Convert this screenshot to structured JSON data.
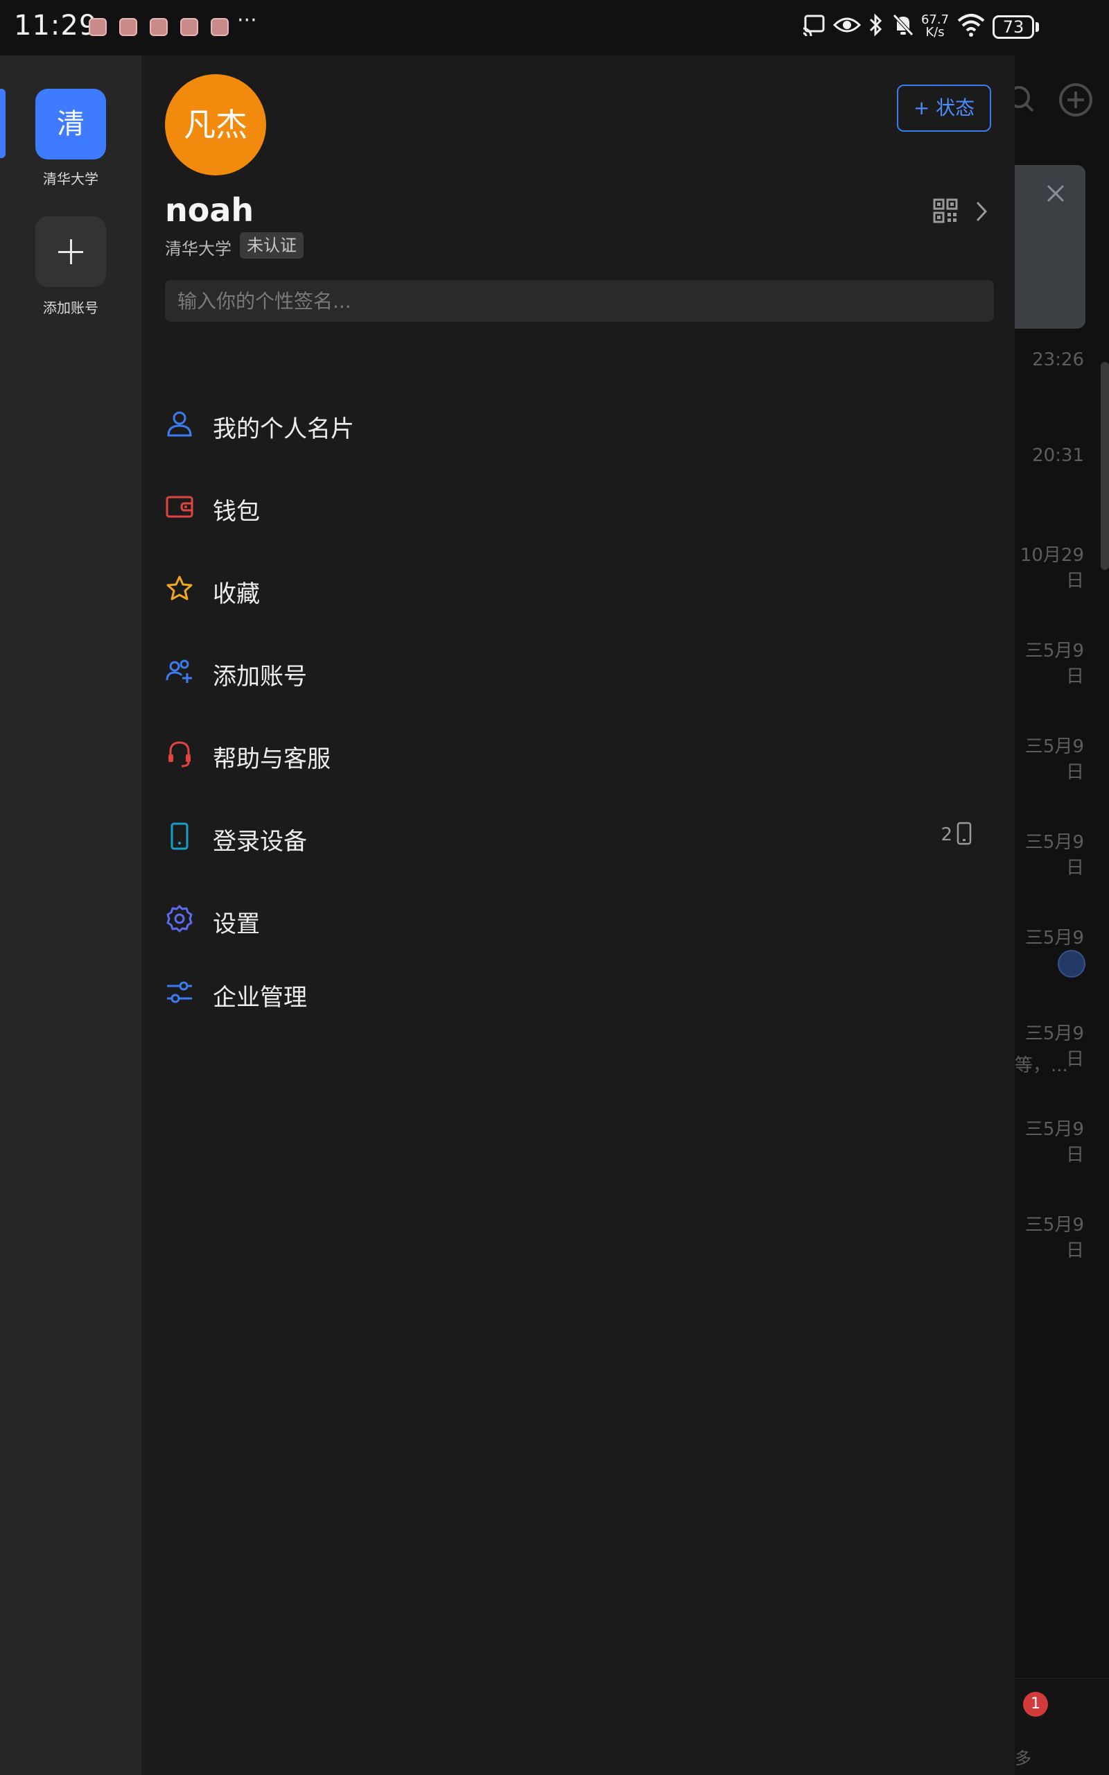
{
  "status_bar": {
    "time": "11:29",
    "more": "···",
    "net_speed_value": "67.7",
    "net_speed_unit": "K/s",
    "battery": "73"
  },
  "account_rail": {
    "org_avatar_text": "清",
    "org_label": "清华大学",
    "add_account_label": "添加账号"
  },
  "profile": {
    "avatar_text": "凡杰",
    "status_button_label": "+ 状态",
    "username": "noah",
    "org_name": "清华大学",
    "verify_badge": "未认证",
    "signature_placeholder": "输入你的个性签名..."
  },
  "menu": {
    "items": [
      {
        "label": "我的个人名片",
        "icon": "person-icon",
        "color": "#3b7df0"
      },
      {
        "label": "钱包",
        "icon": "wallet-icon",
        "color": "#e0443e"
      },
      {
        "label": "收藏",
        "icon": "star-icon",
        "color": "#f2a71b"
      },
      {
        "label": "添加账号",
        "icon": "add-user-icon",
        "color": "#3b7df0"
      },
      {
        "label": "帮助与客服",
        "icon": "headset-icon",
        "color": "#e0443e"
      },
      {
        "label": "登录设备",
        "icon": "phone-icon",
        "color": "#19a0c8"
      },
      {
        "label": "设置",
        "icon": "gear-icon",
        "color": "#5b6cf0"
      },
      {
        "label": "企业管理",
        "icon": "sliders-icon",
        "color": "#3b7df0"
      }
    ],
    "device_count": "2"
  },
  "background": {
    "times": [
      "23:26",
      "20:31",
      "10月29日",
      "三5月9日",
      "三5月9日",
      "三5月9日",
      "三5月9日",
      "三5月9日",
      "三5月9日",
      "三5月9日"
    ],
    "snippet": "等，...",
    "badge": "1",
    "more": "多"
  },
  "colors": {
    "accent": "#3f7bff",
    "avatar": "#f28a0e",
    "drawer_bg": "#1b1b1b",
    "rail_bg": "#262626"
  }
}
